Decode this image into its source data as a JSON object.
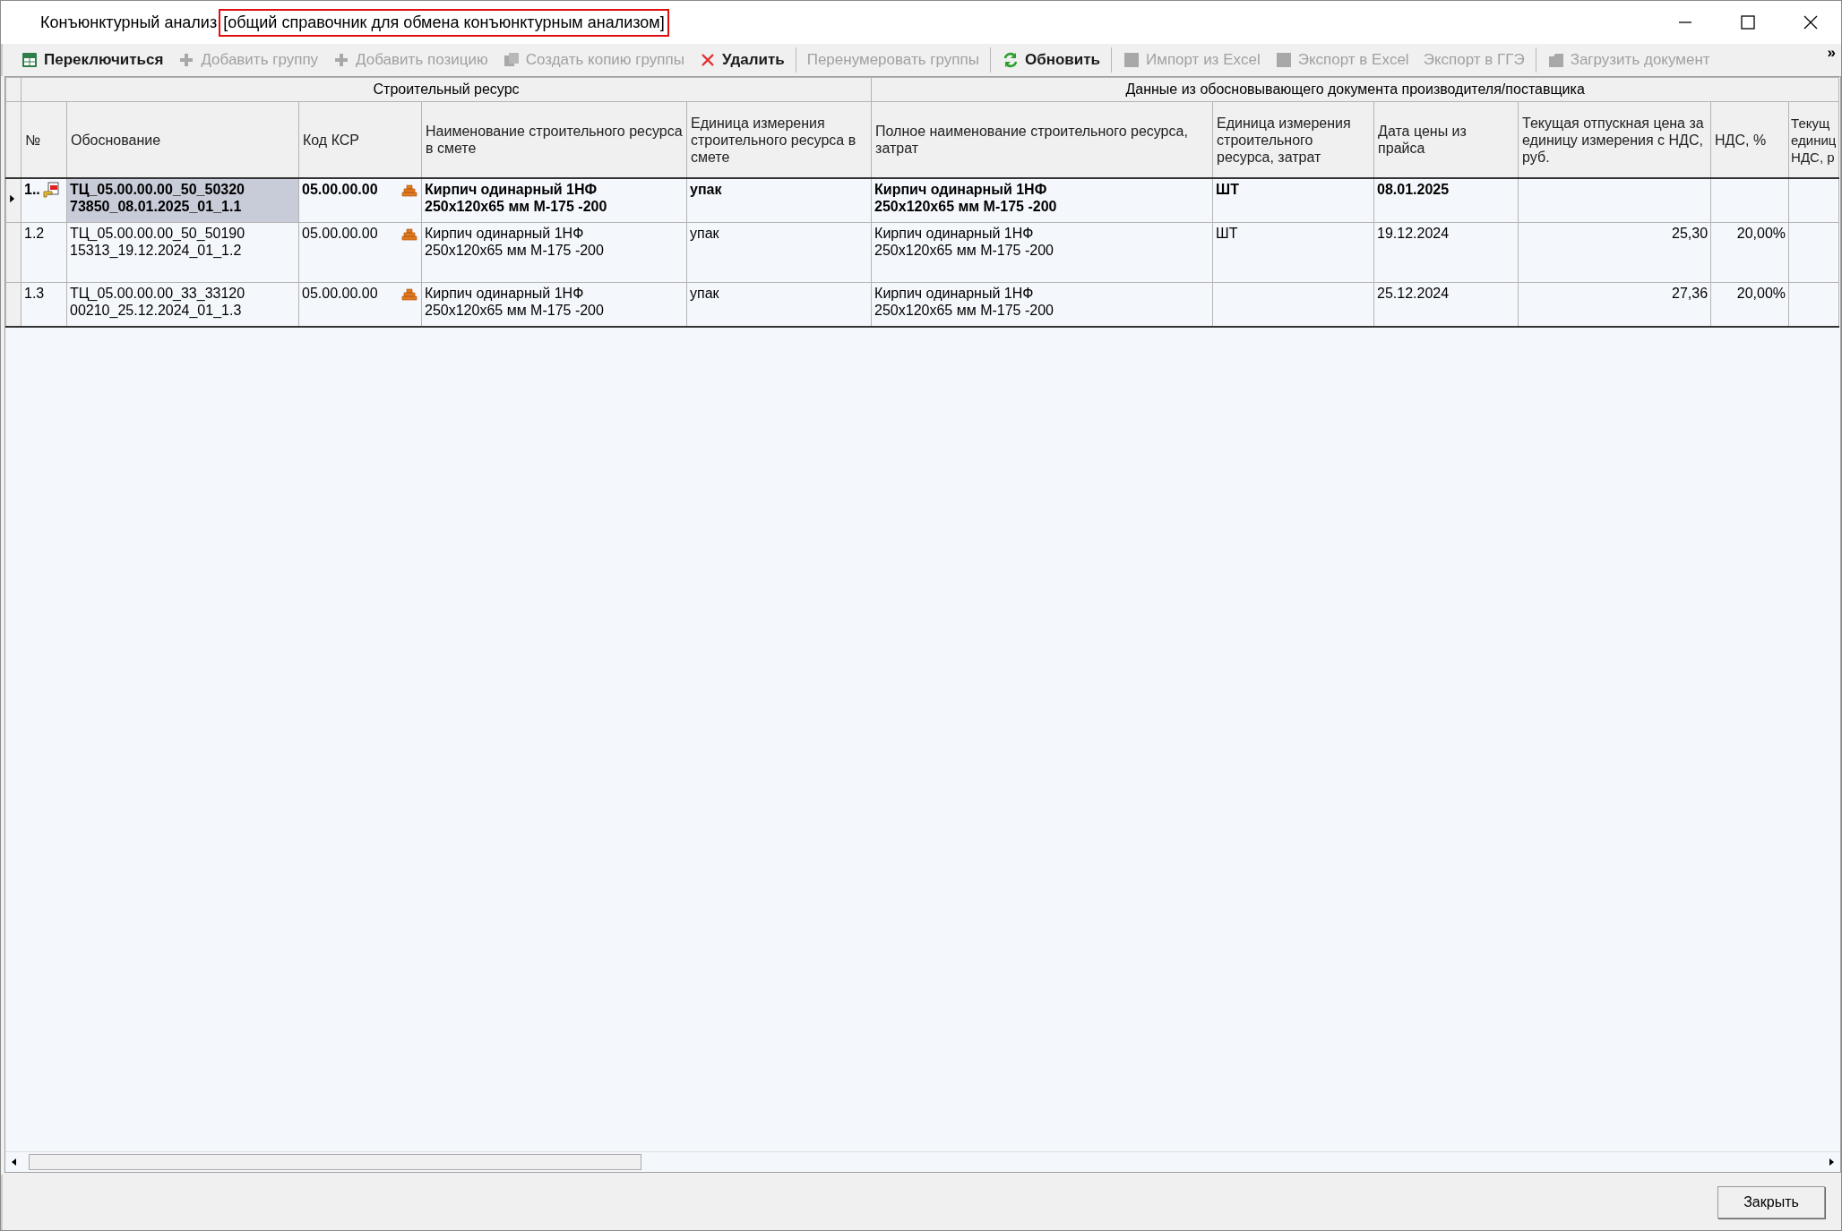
{
  "window": {
    "title": "Конъюнктурный анализ",
    "title_note": "[общий справочник для обмена конъюнктурным анализом]"
  },
  "toolbar": [
    {
      "kind": "switch",
      "label": "Переключиться",
      "disabled": false
    },
    {
      "kind": "add",
      "label": "Добавить группу",
      "disabled": true
    },
    {
      "kind": "add",
      "label": "Добавить позицию",
      "disabled": true
    },
    {
      "kind": "copy",
      "label": "Создать копию группы",
      "disabled": true
    },
    {
      "kind": "delete",
      "label": "Удалить",
      "disabled": false
    },
    {
      "kind": "separator"
    },
    {
      "kind": "text",
      "label": "Перенумеровать группы",
      "disabled": true
    },
    {
      "kind": "separator"
    },
    {
      "kind": "refresh",
      "label": "Обновить",
      "disabled": false
    },
    {
      "kind": "separator"
    },
    {
      "kind": "sheet",
      "label": "Импорт из Excel",
      "disabled": true
    },
    {
      "kind": "sheet",
      "label": "Экспорт в Excel",
      "disabled": true
    },
    {
      "kind": "text",
      "label": "Экспорт в ГГЭ",
      "disabled": true
    },
    {
      "kind": "separator"
    },
    {
      "kind": "load",
      "label": "Загрузить документ",
      "disabled": true
    },
    {
      "kind": "more",
      "label": "»"
    }
  ],
  "table": {
    "groups": [
      {
        "label": "Строительный ресурс"
      },
      {
        "label": "Данные из обосновывающего документа производителя/поставщика"
      }
    ],
    "columns": [
      "№",
      "Обоснование",
      "Код КСР",
      "Наименование строительного ресурса в смете",
      "Единица измерения строительного ресурса в смете",
      "Полное наименование строительного ресурса, затрат",
      "Единица измерения строительного ресурса, затрат",
      "Дата цены из прайса",
      "Текущая отпускная цена за единицу измерения с НДС, руб.",
      "НДС, %",
      "Текущ единиц НДС, р"
    ],
    "rows": [
      {
        "selected": true,
        "cells": [
          "1..",
          "ТЦ_05.00.00.00_50_50320 73850_08.01.2025_01_1.1",
          "05.00.00.00",
          "Кирпич одинарный 1НФ 250x120x65 мм М-175 -200",
          "упак",
          "Кирпич одинарный 1НФ 250x120x65 мм М-175 -200",
          "ШТ",
          "08.01.2025",
          "",
          "",
          ""
        ]
      },
      {
        "selected": false,
        "cells": [
          "1.2",
          "ТЦ_05.00.00.00_50_50190 15313_19.12.2024_01_1.2",
          "05.00.00.00",
          "Кирпич одинарный 1НФ 250x120x65 мм М-175 -200",
          "упак",
          "Кирпич одинарный 1НФ 250x120x65 мм М-175 -200",
          "ШТ",
          "19.12.2024",
          "25,30",
          "20,00%",
          ""
        ]
      },
      {
        "selected": false,
        "cells": [
          "1.3",
          "ТЦ_05.00.00.00_33_33120 00210_25.12.2024_01_1.3",
          "05.00.00.00",
          "Кирпич одинарный 1НФ 250x120x65 мм М-175 -200",
          "упак",
          "Кирпич одинарный 1НФ 250x120x65 мм М-175 -200",
          "",
          "25.12.2024",
          "27,36",
          "20,00%",
          ""
        ]
      }
    ]
  },
  "buttons": [
    {
      "label": "Закрыть"
    }
  ]
}
